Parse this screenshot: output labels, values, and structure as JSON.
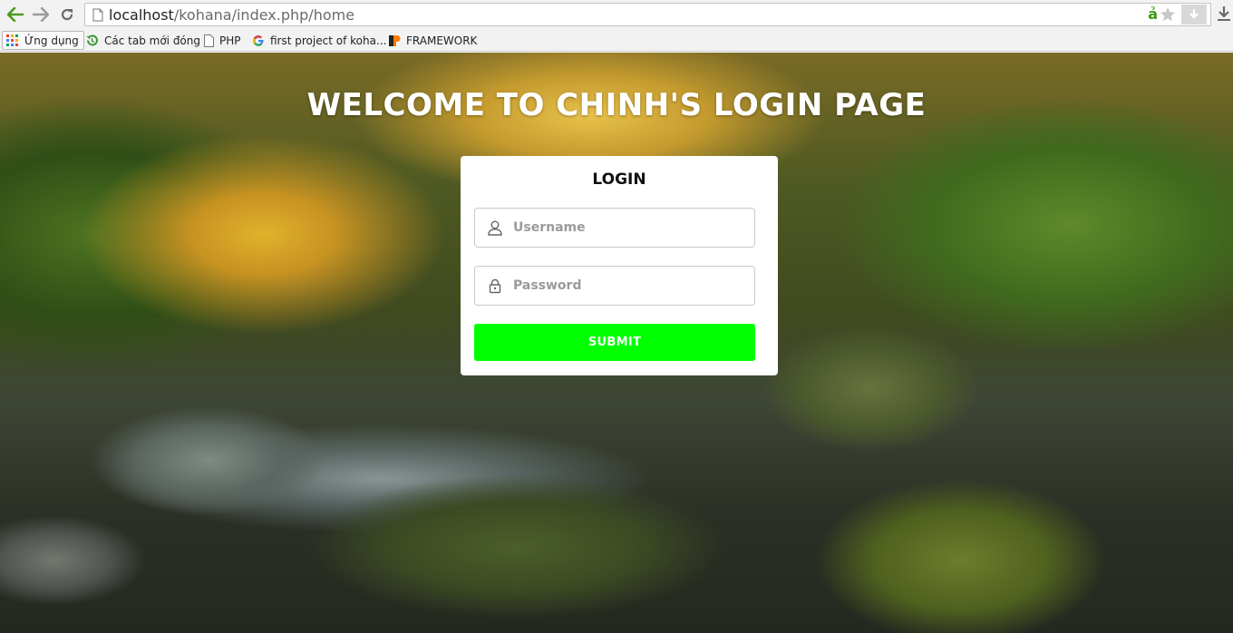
{
  "browser": {
    "url_host": "localhost",
    "url_path": "/kohana/index.php/home",
    "extension_glyph": "ả",
    "bookmarks": [
      {
        "label": "Ứng dụng",
        "icon": "apps-grid-icon"
      },
      {
        "label": "Các tab mới đóng",
        "icon": "history-icon"
      },
      {
        "label": "PHP",
        "icon": "page-icon"
      },
      {
        "label": "first project of koha...",
        "icon": "google-icon"
      },
      {
        "label": "FRAMEWORK",
        "icon": "framework-icon"
      }
    ]
  },
  "page": {
    "title": "WELCOME TO CHINH'S LOGIN PAGE",
    "login": {
      "heading": "LOGIN",
      "username_placeholder": "Username",
      "password_placeholder": "Password",
      "submit_label": "SUBMIT"
    }
  },
  "colors": {
    "submit_button": "#00ff00",
    "card_background": "#ffffff"
  }
}
